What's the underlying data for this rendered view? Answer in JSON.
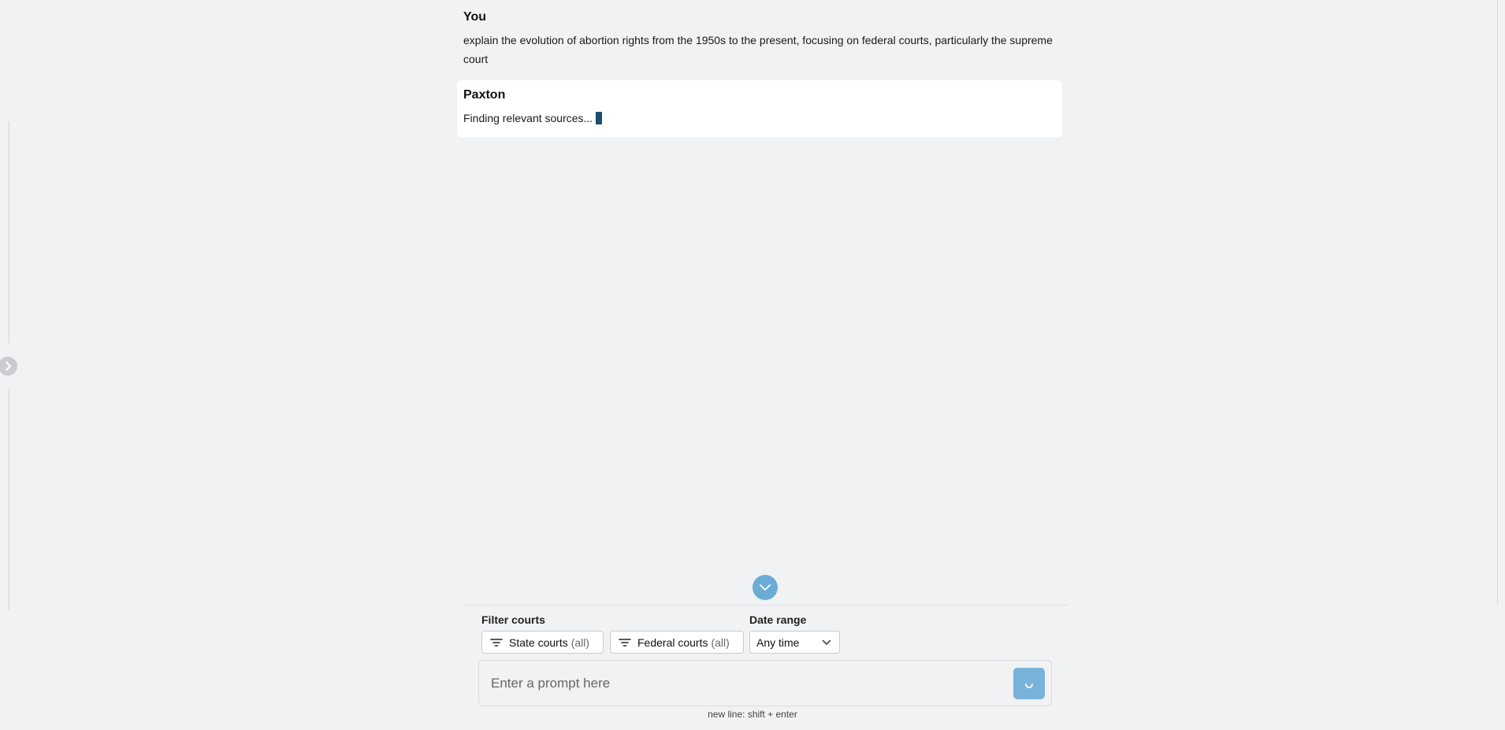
{
  "conversation": {
    "user": {
      "author": "You",
      "text": "explain the evolution of abortion rights from the 1950s to the present, focusing on federal courts, particularly the supreme court"
    },
    "assistant": {
      "author": "Paxton",
      "text": "Finding relevant sources..."
    }
  },
  "filters": {
    "courts_label": "Filter courts",
    "state_courts": {
      "label": "State courts",
      "scope": "(all)"
    },
    "federal_courts": {
      "label": "Federal courts",
      "scope": "(all)"
    },
    "date_label": "Date range",
    "date_value": "Any time"
  },
  "prompt": {
    "placeholder": "Enter a prompt here",
    "hint": "new line: shift + enter"
  },
  "colors": {
    "accent": "#6bacd6",
    "send_button": "#79b3da",
    "cursor": "#1e4d6e",
    "background": "#f0f2f4"
  },
  "icons": {
    "sidebar_toggle": "chevron-right-icon",
    "scroll_down": "chevron-down-icon",
    "filter": "filter-lines-icon",
    "select": "chevron-down-icon",
    "send": "loading-spinner-icon"
  }
}
